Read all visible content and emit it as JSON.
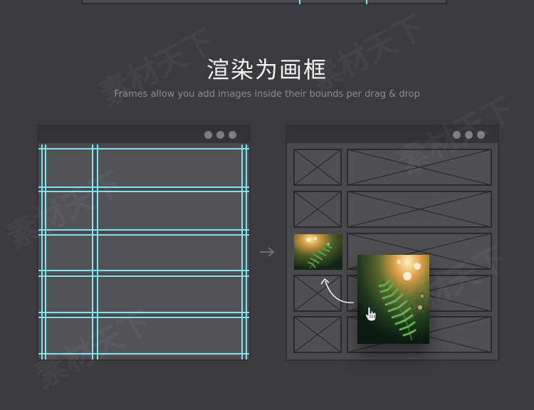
{
  "header": {
    "title": "渲染为画框",
    "subtitle": "Frames allow you add images inside their bounds per drag & drop"
  },
  "colors": {
    "background": "#3b3b3e",
    "window": "#4a4a4c",
    "titlebar": "#333335",
    "guide": "#7fe3f2",
    "frame_stroke": "#2a2a2c"
  },
  "icons": {
    "arrow": "right-arrow-icon",
    "cursor": "hand-cursor-icon",
    "window_controls": "window-dot-icon"
  },
  "watermark": {
    "text": "素材天下"
  }
}
